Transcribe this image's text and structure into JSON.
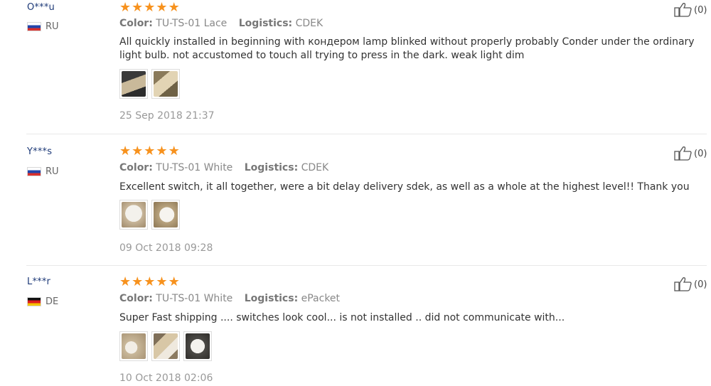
{
  "colors": {
    "star": "#f7921e",
    "username": "#1e3a78",
    "divider": "#e8e8e8"
  },
  "labels": {
    "color": "Color:",
    "logistics": "Logistics:"
  },
  "reviews": [
    {
      "user": "O***u",
      "country": "RU",
      "flag": "flag-ru",
      "rating": 5,
      "color": "TU-TS-01 Lace",
      "logistics": "CDEK",
      "text": "All quickly installed in beginning with кондером lamp blinked without properly probably Conder under the ordinary light bulb. not accustomed to touch all trying to press in the dark. weak light dim",
      "photo_count": 2,
      "date": "25 Sep 2018 21:37",
      "helpful": "(0)"
    },
    {
      "user": "Y***s",
      "country": "RU",
      "flag": "flag-ru",
      "rating": 5,
      "color": "TU-TS-01 White",
      "logistics": "CDEK",
      "text": "Excellent switch, it all together, were a bit delay delivery sdek, as well as a whole at the highest level!! Thank you",
      "photo_count": 2,
      "date": "09 Oct 2018 09:28",
      "helpful": "(0)"
    },
    {
      "user": "L***r",
      "country": "DE",
      "flag": "flag-de",
      "rating": 5,
      "color": "TU-TS-01 White",
      "logistics": "ePacket",
      "text": "Super Fast shipping .... switches look cool... is not installed .. did not communicate with...",
      "photo_count": 3,
      "date": "10 Oct 2018 02:06",
      "helpful": "(0)"
    }
  ]
}
